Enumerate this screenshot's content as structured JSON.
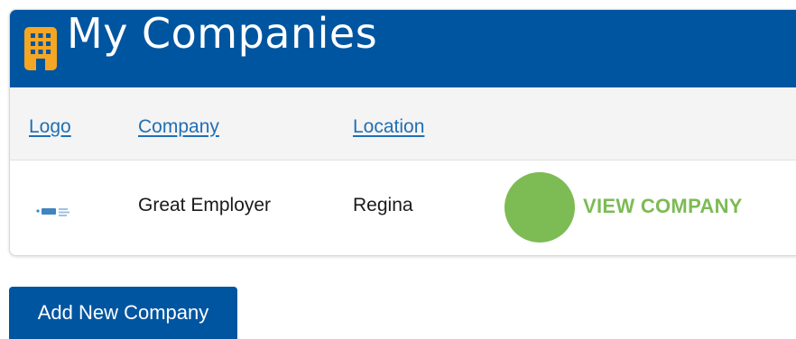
{
  "panel": {
    "title": "My Companies",
    "icon": "building-icon"
  },
  "table": {
    "columns": [
      "Logo",
      "Company",
      "Location"
    ],
    "rows": [
      {
        "logo": "company-logo-image",
        "company": "Great Employer",
        "location": "Regina",
        "action": "VIEW COMPANY"
      }
    ]
  },
  "actions": {
    "add_label": "Add New Company"
  },
  "colors": {
    "header_bg": "#0055a0",
    "icon": "#f5a623",
    "link": "#1f6fb5",
    "accent_green": "#7dbb55",
    "button_bg": "#0055a0"
  }
}
